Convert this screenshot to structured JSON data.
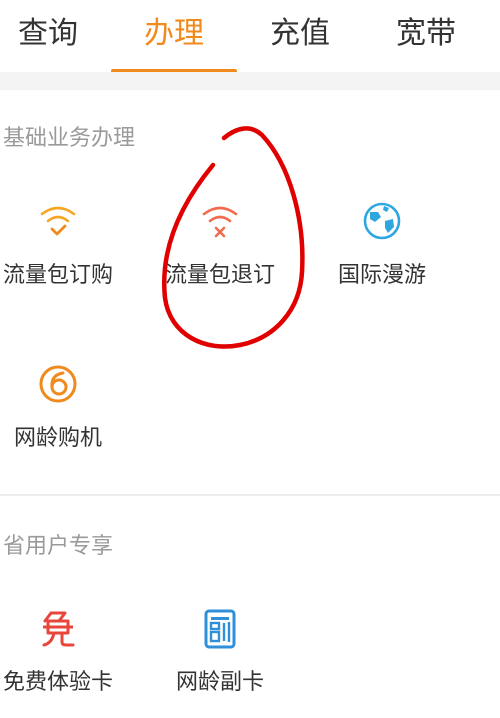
{
  "tabs": [
    {
      "label": "查询",
      "active": false
    },
    {
      "label": "办理",
      "active": true
    },
    {
      "label": "充值",
      "active": false
    },
    {
      "label": "宽带",
      "active": false
    }
  ],
  "sections": {
    "basic": {
      "title": "基础业务办理",
      "items": [
        {
          "label": "流量包订购",
          "icon": "wifi-check-icon"
        },
        {
          "label": "流量包退订",
          "icon": "wifi-cancel-icon"
        },
        {
          "label": "国际漫游",
          "icon": "globe-icon"
        },
        {
          "label": "网龄购机",
          "icon": "phone-purchase-icon"
        }
      ]
    },
    "province": {
      "title": "省用户专享",
      "items": [
        {
          "label": "免费体验卡",
          "icon": "free-card-icon"
        },
        {
          "label": "网龄副卡",
          "icon": "sub-card-icon"
        }
      ]
    }
  },
  "colors": {
    "accent": "#f08a1c",
    "wifi_cancel": "#f26b4f",
    "globe": "#2ea7e0",
    "free_card": "#e8463a",
    "sub_card": "#2f8fd8",
    "annotation": "#e00000"
  }
}
